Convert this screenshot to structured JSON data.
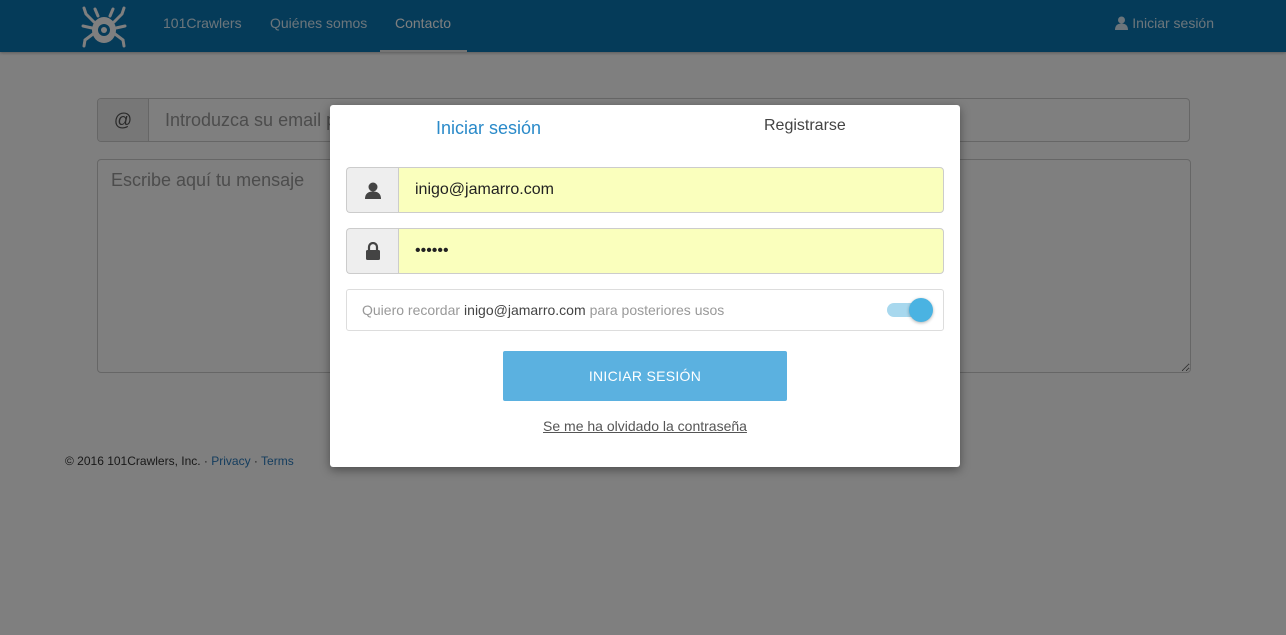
{
  "navbar": {
    "brand": "101Crawlers",
    "links": [
      {
        "label": "101Crawlers"
      },
      {
        "label": "Quiénes somos"
      },
      {
        "label": "Contacto"
      }
    ],
    "login_label": "Iniciar sesión",
    "logo_icon": "spider-logo-icon",
    "user_icon": "user-icon",
    "color": "#0b77b3"
  },
  "contact_form": {
    "email_addon": "@",
    "email_placeholder": "Introduzca su email para contactar",
    "message_placeholder": "Escribe aquí tu mensaje"
  },
  "footer": {
    "copyright": "© 2016 101Crawlers, Inc. · ",
    "privacy": "Privacy",
    "separator": " · ",
    "terms": "Terms"
  },
  "modal": {
    "tabs": [
      {
        "label": "Iniciar sesión",
        "active": true
      },
      {
        "label": "Registrarse",
        "active": false
      }
    ],
    "username_value": "inigo@jamarro.com",
    "password_value": "••••••",
    "remember": {
      "prefix": "Quiero recordar",
      "email": "inigo@jamarro.com",
      "suffix": "para posteriores usos",
      "enabled": true
    },
    "submit_label": "INICIAR SESIÓN",
    "forgot_label": "Se me ha olvidado la contraseña",
    "accent_color": "#2a8ac9",
    "button_color": "#5bb1e0",
    "autofill_color": "#faffbd"
  }
}
